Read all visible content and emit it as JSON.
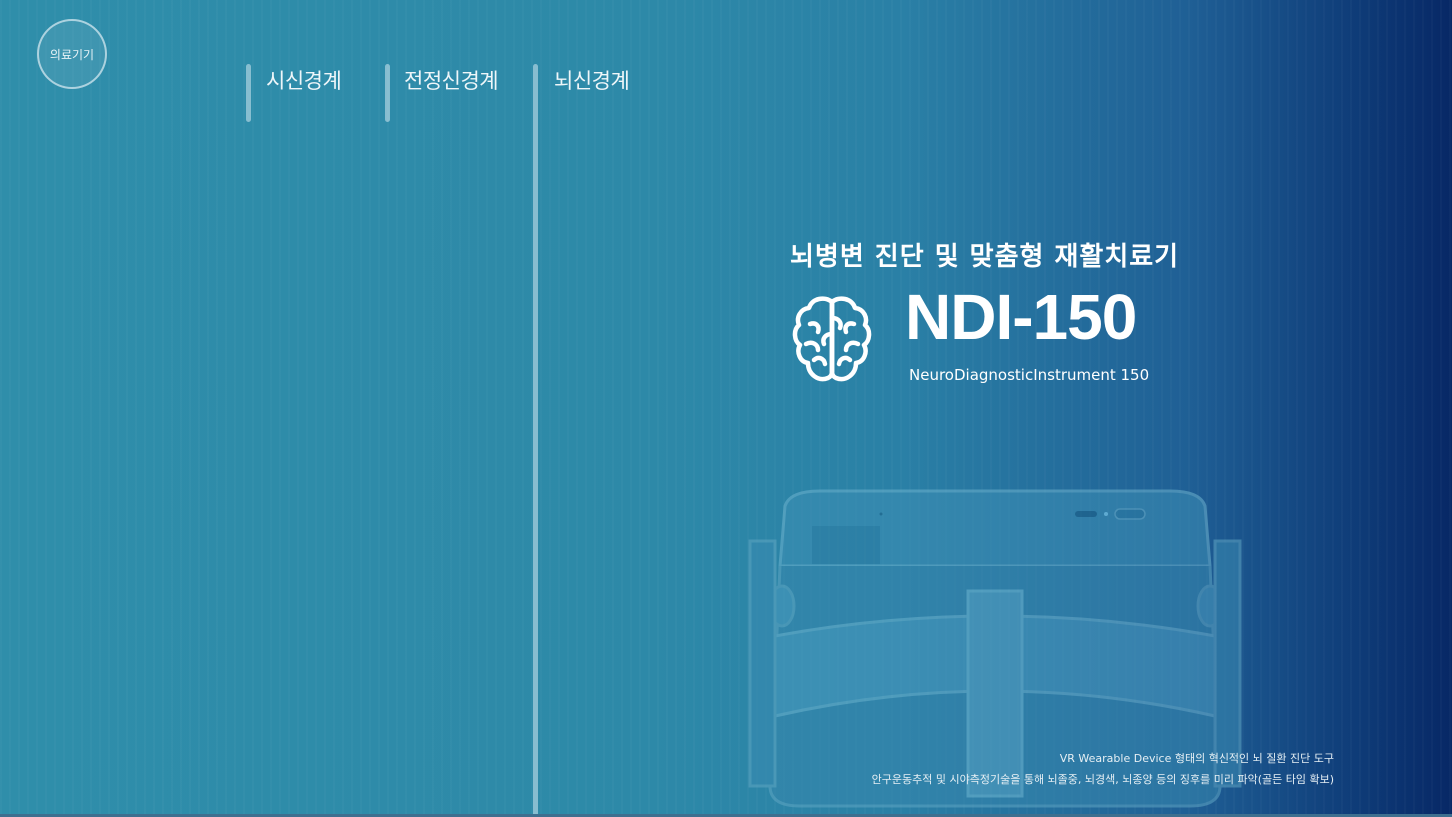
{
  "badge": {
    "label": "의료기기"
  },
  "nav": {
    "items": [
      {
        "label": "시신경계"
      },
      {
        "label": "전정신경계"
      },
      {
        "label": "뇌신경계"
      }
    ]
  },
  "hero": {
    "headline": "뇌병변 진단 및 맞춤형 재활치료기",
    "product_name": "NDI-150",
    "product_fullname": "NeuroDiagnosticInstrument 150",
    "icon": "brain-icon"
  },
  "footer": {
    "line1": "VR  Wearable Device 형태의 혁신적인 뇌 질환 진단 도구",
    "line2": "안구운동추적 및 시야측정기술을 통해 뇌졸중, 뇌경색, 뇌종양 등의 징후를 미리 파악(골든 타임 확보)"
  },
  "colors": {
    "gradient_left": "#2f8eaa",
    "gradient_right": "#072866",
    "text": "#ffffff"
  }
}
